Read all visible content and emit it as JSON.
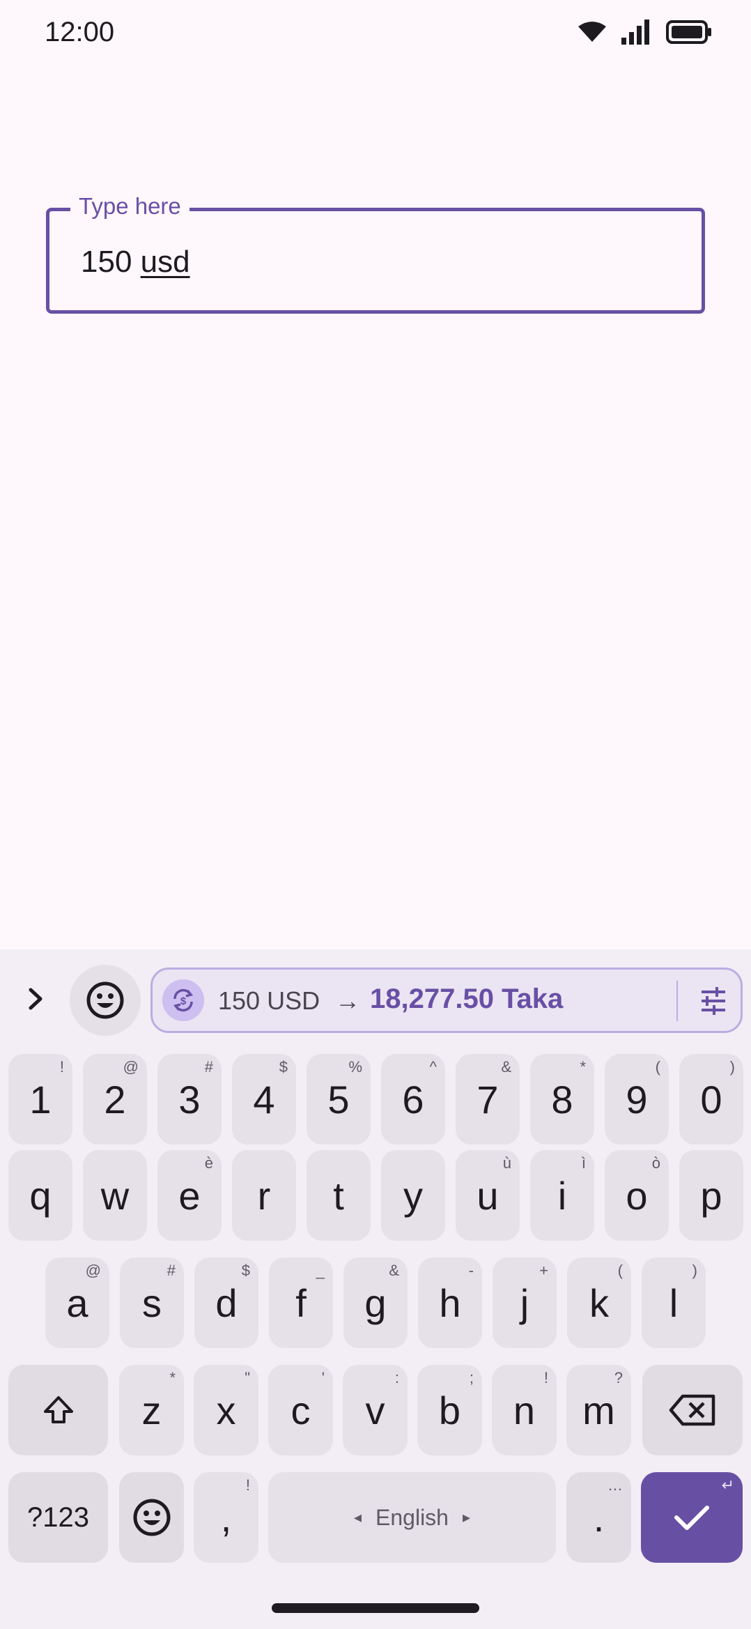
{
  "status_bar": {
    "time": "12:00"
  },
  "text_field": {
    "label": "Type here",
    "value_prefix": "150 ",
    "value_word": "usd"
  },
  "suggestion": {
    "from": "150 USD",
    "arrow": "→",
    "to": "18,277.50 Taka"
  },
  "keyboard": {
    "number_row": [
      {
        "main": "1",
        "sec": "!"
      },
      {
        "main": "2",
        "sec": "@"
      },
      {
        "main": "3",
        "sec": "#"
      },
      {
        "main": "4",
        "sec": "$"
      },
      {
        "main": "5",
        "sec": "%"
      },
      {
        "main": "6",
        "sec": "^"
      },
      {
        "main": "7",
        "sec": "&"
      },
      {
        "main": "8",
        "sec": "*"
      },
      {
        "main": "9",
        "sec": "("
      },
      {
        "main": "0",
        "sec": ")"
      }
    ],
    "row1": [
      {
        "main": "q",
        "sec": ""
      },
      {
        "main": "w",
        "sec": ""
      },
      {
        "main": "e",
        "sec": "è"
      },
      {
        "main": "r",
        "sec": ""
      },
      {
        "main": "t",
        "sec": ""
      },
      {
        "main": "y",
        "sec": ""
      },
      {
        "main": "u",
        "sec": "ù"
      },
      {
        "main": "i",
        "sec": "ì"
      },
      {
        "main": "o",
        "sec": "ò"
      },
      {
        "main": "p",
        "sec": ""
      }
    ],
    "row2": [
      {
        "main": "a",
        "sec": "@"
      },
      {
        "main": "s",
        "sec": "#"
      },
      {
        "main": "d",
        "sec": "$"
      },
      {
        "main": "f",
        "sec": "_"
      },
      {
        "main": "g",
        "sec": "&"
      },
      {
        "main": "h",
        "sec": "-"
      },
      {
        "main": "j",
        "sec": "+"
      },
      {
        "main": "k",
        "sec": "("
      },
      {
        "main": "l",
        "sec": ")"
      }
    ],
    "row3": [
      {
        "main": "z",
        "sec": "*"
      },
      {
        "main": "x",
        "sec": "\""
      },
      {
        "main": "c",
        "sec": "'"
      },
      {
        "main": "v",
        "sec": ":"
      },
      {
        "main": "b",
        "sec": ";"
      },
      {
        "main": "n",
        "sec": "!"
      },
      {
        "main": "m",
        "sec": "?"
      }
    ],
    "bottom": {
      "symbols": "?123",
      "comma": ",",
      "comma_sec": "!",
      "space": "English",
      "space_left": "◂",
      "space_right": "▸",
      "period": ".",
      "period_sec": "…",
      "enter_sec": "↵"
    }
  },
  "icons": {
    "wifi": "wifi-icon",
    "signal": "signal-icon",
    "battery": "battery-icon",
    "expand": "chevron-right-icon",
    "emoji": "emoji-icon",
    "convert": "currency-convert-icon",
    "settings": "tune-icon",
    "shift": "shift-icon",
    "backspace": "backspace-icon",
    "enter": "check-icon"
  },
  "colors": {
    "accent": "#6750a4",
    "background": "#fef7fc",
    "keyboard_bg": "#f3eef6",
    "key_bg": "#e6e0e8"
  }
}
